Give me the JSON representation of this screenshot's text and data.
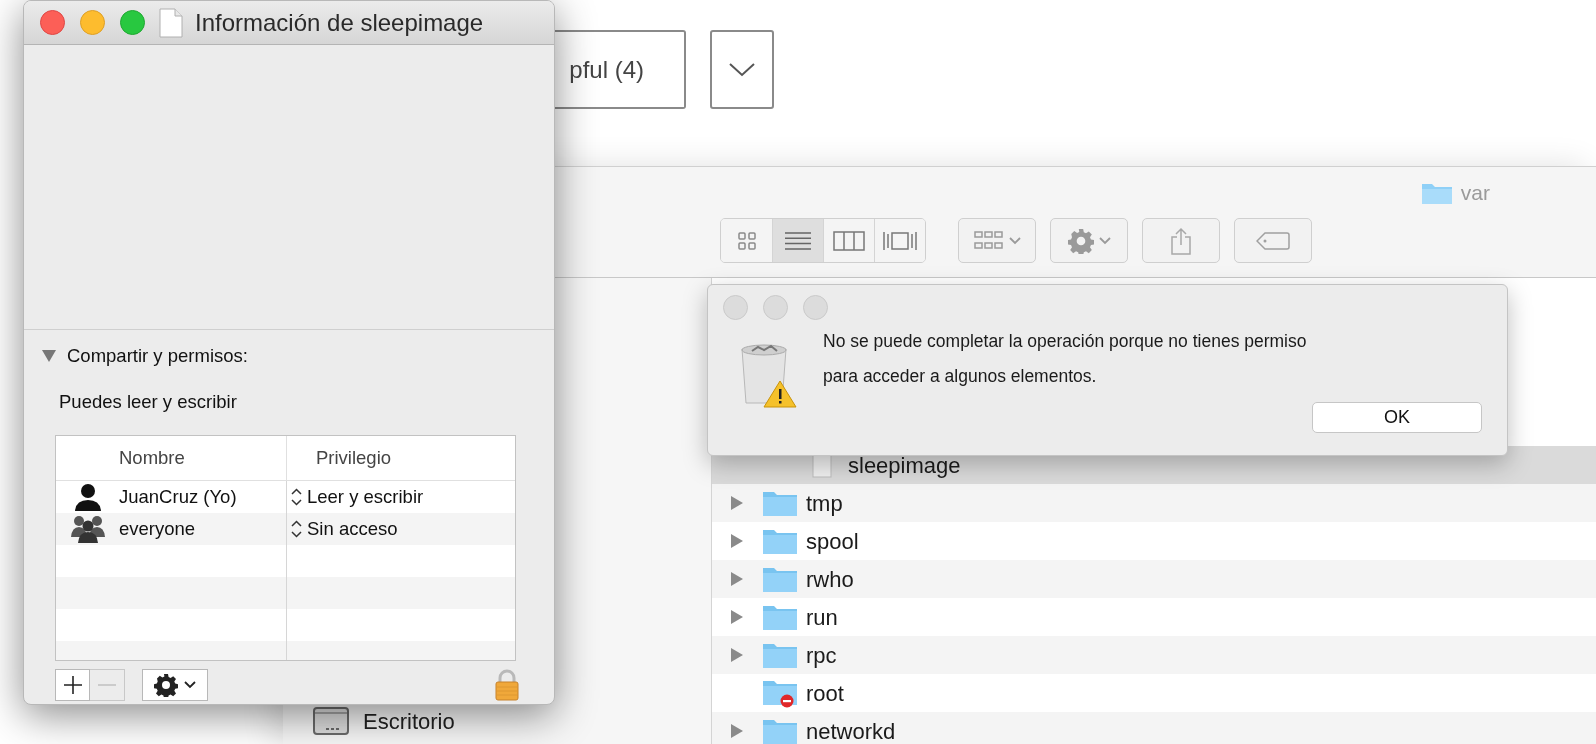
{
  "background_page": {
    "buttons": [
      {
        "kind": "text",
        "label": "pful (4)"
      },
      {
        "kind": "chevron"
      }
    ]
  },
  "finder": {
    "path_title": "var",
    "view_modes": [
      {
        "kind": "icons",
        "selected": false
      },
      {
        "kind": "list",
        "selected": true
      },
      {
        "kind": "columns",
        "selected": false
      },
      {
        "kind": "gallery",
        "selected": false
      }
    ],
    "sidebar_items": [
      {
        "label": "Escritorio"
      }
    ],
    "files": [
      {
        "name": "sleepimage",
        "kind": "file",
        "expandable": false,
        "selected": true
      },
      {
        "name": "tmp",
        "kind": "folder",
        "expandable": true,
        "selected": false
      },
      {
        "name": "spool",
        "kind": "folder",
        "expandable": true,
        "selected": false
      },
      {
        "name": "rwho",
        "kind": "folder",
        "expandable": true,
        "selected": false
      },
      {
        "name": "run",
        "kind": "folder",
        "expandable": true,
        "selected": false
      },
      {
        "name": "rpc",
        "kind": "folder",
        "expandable": true,
        "selected": false
      },
      {
        "name": "root",
        "kind": "locked_folder",
        "expandable": false,
        "selected": false
      },
      {
        "name": "networkd",
        "kind": "folder",
        "expandable": true,
        "selected": false
      }
    ]
  },
  "alert": {
    "message": "No se puede completar la operación porque no tienes permiso para acceder a algunos elementos.",
    "button": "OK"
  },
  "info_window": {
    "title": "Información de sleepimage",
    "section": {
      "title": "Compartir y permisos:",
      "expanded": true
    },
    "summary": "Puedes leer y escribir",
    "columns": [
      "Nombre",
      "Privilegio"
    ],
    "permissions": [
      {
        "kind": "user",
        "name": "JuanCruz (Yo)",
        "privilege": "Leer y escribir"
      },
      {
        "kind": "group",
        "name": "everyone",
        "privilege": "Sin acceso"
      }
    ]
  }
}
